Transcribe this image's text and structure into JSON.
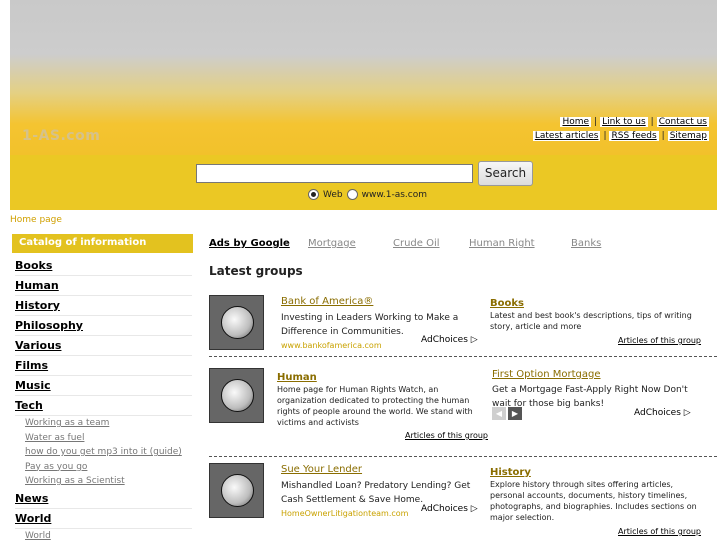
{
  "header": {
    "logo": "1-AS.com",
    "links_row1": [
      "Home",
      "Link to us",
      "Contact us"
    ],
    "links_row2": [
      "Latest articles",
      "RSS feeds",
      "Sitemap"
    ]
  },
  "search": {
    "value": "",
    "button": "Search",
    "options": [
      "Web",
      "www.1-as.com"
    ],
    "selected": "Web"
  },
  "breadcrumb": "Home page",
  "sidebar": {
    "title": "Catalog of information",
    "items": [
      {
        "label": "Books"
      },
      {
        "label": "Human"
      },
      {
        "label": "History"
      },
      {
        "label": "Philosophy"
      },
      {
        "label": "Various"
      },
      {
        "label": "Films"
      },
      {
        "label": "Music"
      },
      {
        "label": "Tech"
      }
    ],
    "tech_sub": [
      "Working as a team",
      "Water as fuel",
      "how do you get mp3 into it (guide)",
      "Pay as you go",
      "Working as a Scientist"
    ],
    "items2": [
      {
        "label": "News"
      },
      {
        "label": "World"
      }
    ],
    "world_sub": [
      "World"
    ]
  },
  "ads_bar": {
    "title": "Ads by Google",
    "links": [
      "Mortgage",
      "Crude Oil",
      "Human Right",
      "Banks"
    ]
  },
  "latest_title": "Latest groups",
  "groups": [
    {
      "ad_title": "Bank of America®",
      "ad_text": "Investing in Leaders Working to Make a Difference in Communities.",
      "ad_url": "www.bankofamerica.com",
      "adchoices": "AdChoices",
      "name": "Books",
      "desc": "Latest and best book's descriptions, tips of writing story, article and more",
      "articles": "Articles of this group"
    },
    {
      "name": "Human",
      "desc": "Home page for Human Rights Watch, an organization dedicated to protecting the human rights of people around the world. We stand with victims and activists",
      "articles": "Articles of this group",
      "ad_title": "First Option Mortgage",
      "ad_text": "Get a Mortgage Fast-Apply Right Now Don't wait for those big banks!",
      "adchoices": "AdChoices"
    },
    {
      "ad_title": "Sue Your Lender",
      "ad_text": "Mishandled Loan? Predatory Lending? Get Cash Settlement & Save Home.",
      "ad_url": "HomeOwnerLitigationteam.com",
      "adchoices": "AdChoices",
      "name": "History",
      "desc": "Explore history through sites offering articles, personal accounts, documents, history timelines, photographs, and biographies. Includes sections on major selection.",
      "articles": "Articles of this group"
    }
  ],
  "colors": {
    "accent": "#ebc824",
    "link": "#8a6d00"
  }
}
